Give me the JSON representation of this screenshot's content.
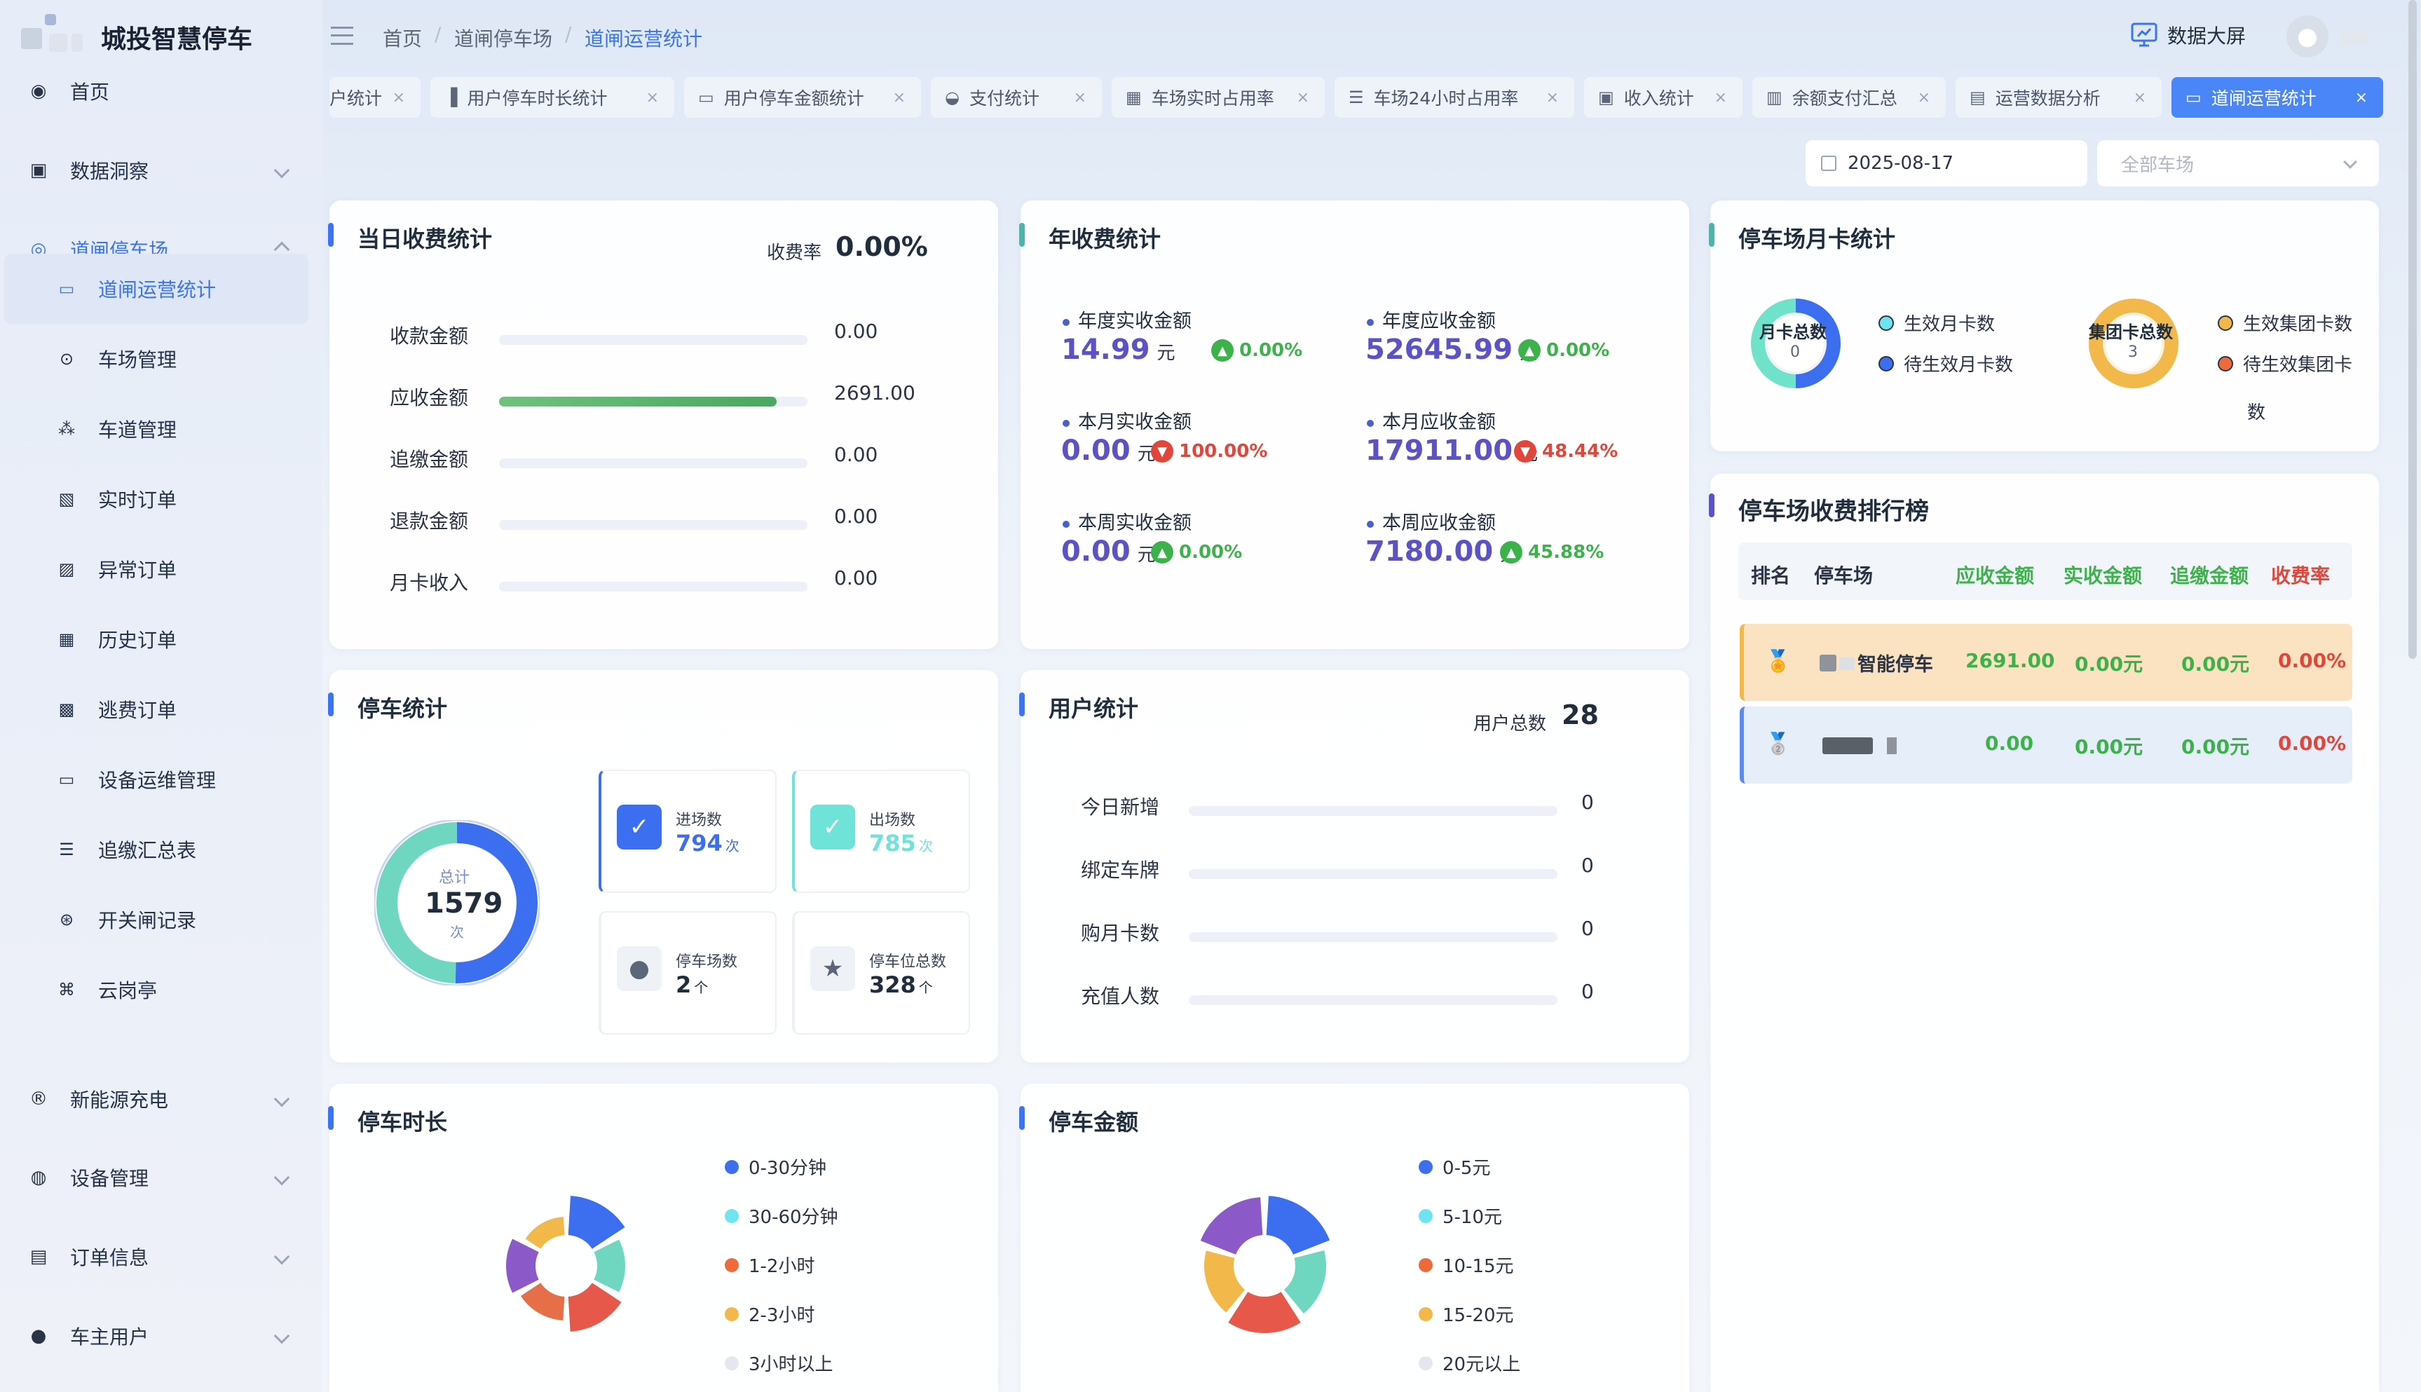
{
  "app": {
    "title": "城投智慧停车"
  },
  "breadcrumb": [
    "首页",
    "道闸停车场",
    "道闸运营统计"
  ],
  "header": {
    "bigscreen": "数据大屏"
  },
  "sidebar": {
    "items": [
      {
        "label": "首页",
        "icon": "dashboard-icon"
      },
      {
        "label": "数据洞察",
        "icon": "monitor-chart-icon"
      },
      {
        "label": "道闸停车场",
        "icon": "location-icon"
      },
      {
        "label": "新能源充电",
        "icon": "charge-icon"
      },
      {
        "label": "设备管理",
        "icon": "device-icon"
      },
      {
        "label": "订单信息",
        "icon": "order-icon"
      },
      {
        "label": "车主用户",
        "icon": "user-icon"
      }
    ],
    "sub": [
      {
        "label": "道闸运营统计",
        "icon": "monitor-icon"
      },
      {
        "label": "车场管理",
        "icon": "pin-icon"
      },
      {
        "label": "车道管理",
        "icon": "lane-icon"
      },
      {
        "label": "实时订单",
        "icon": "realtime-order-icon"
      },
      {
        "label": "异常订单",
        "icon": "abnormal-order-icon"
      },
      {
        "label": "历史订单",
        "icon": "history-order-icon"
      },
      {
        "label": "逃费订单",
        "icon": "evade-order-icon"
      },
      {
        "label": "设备运维管理",
        "icon": "maintenance-icon"
      },
      {
        "label": "追缴汇总表",
        "icon": "list-icon"
      },
      {
        "label": "开关闸记录",
        "icon": "gate-record-icon"
      },
      {
        "label": "云岗亭",
        "icon": "cloud-booth-icon"
      }
    ]
  },
  "tabs": [
    "户统计",
    "用户停车时长统计",
    "用户停车金额统计",
    "支付统计",
    "车场实时占用率",
    "车场24小时占用率",
    "收入统计",
    "余额支付汇总",
    "运营数据分析",
    "道闸运营统计"
  ],
  "filters": {
    "date": "2025-08-17",
    "parking_placeholder": "全部车场"
  },
  "daily": {
    "title": "当日收费统计",
    "rate_label": "收费率",
    "rate": "0.00%",
    "rows": [
      {
        "label": "收款金额",
        "value": "0.00",
        "fraction": 0
      },
      {
        "label": "应收金额",
        "value": "2691.00",
        "fraction": 0.9
      },
      {
        "label": "追缴金额",
        "value": "0.00",
        "fraction": 0
      },
      {
        "label": "退款金额",
        "value": "0.00",
        "fraction": 0
      },
      {
        "label": "月卡收入",
        "value": "0.00",
        "fraction": 0
      }
    ]
  },
  "annual": {
    "title": "年收费统计",
    "unit": "元",
    "stats": [
      {
        "label": "年度实收金额",
        "value": "14.99",
        "trend": "0.00%",
        "dir": "up"
      },
      {
        "label": "年度应收金额",
        "value": "52645.99",
        "trend": "0.00%",
        "dir": "up"
      },
      {
        "label": "本月实收金额",
        "value": "0.00",
        "trend": "100.00%",
        "dir": "down"
      },
      {
        "label": "本月应收金额",
        "value": "17911.00",
        "trend": "48.44%",
        "dir": "down"
      },
      {
        "label": "本周实收金额",
        "value": "0.00",
        "trend": "0.00%",
        "dir": "up"
      },
      {
        "label": "本周应收金额",
        "value": "7180.00",
        "trend": "45.88%",
        "dir": "up"
      }
    ]
  },
  "monthly_card": {
    "title": "停车场月卡统计",
    "month_total_label": "月卡总数",
    "month_total": "0",
    "group_total_label": "集团卡总数",
    "group_total": "3",
    "legend": [
      {
        "label": "生效月卡数",
        "color": "#6fe3f0"
      },
      {
        "label": "待生效月卡数",
        "color": "#3b6ff0"
      },
      {
        "label": "生效集团卡数",
        "color": "#f2b94a"
      },
      {
        "label": "待生效集团卡",
        "color": "#ee6a3a"
      }
    ],
    "legend_wrap": "数"
  },
  "ranking": {
    "title": "停车场收费排行榜",
    "headers": [
      "排名",
      "停车场",
      "应收金额",
      "实收金额",
      "追缴金额",
      "收费率"
    ],
    "rows": [
      {
        "name": "智能停车",
        "receivable": "2691.00",
        "received": "0.00元",
        "recovered": "0.00元",
        "rate": "0.00%"
      },
      {
        "name": "",
        "receivable": "0.00",
        "received": "0.00元",
        "recovered": "0.00元",
        "rate": "0.00%"
      }
    ]
  },
  "parking": {
    "title": "停车统计",
    "total_label": "总计",
    "total": "1579",
    "total_unit": "次",
    "in_ratio": 0.503,
    "boxes": [
      {
        "label": "进场数",
        "value": "794",
        "unit": "次",
        "color": "#3b6ff0"
      },
      {
        "label": "出场数",
        "value": "785",
        "unit": "次",
        "color": "#6fe3d8"
      },
      {
        "label": "停车场数",
        "value": "2",
        "unit": "个",
        "color": "#5b6678"
      },
      {
        "label": "停车位总数",
        "value": "328",
        "unit": "个",
        "color": "#5b6678"
      }
    ]
  },
  "users": {
    "title": "用户统计",
    "total_label": "用户总数",
    "total": "28",
    "rows": [
      {
        "label": "今日新增",
        "value": "0"
      },
      {
        "label": "绑定车牌",
        "value": "0"
      },
      {
        "label": "购月卡数",
        "value": "0"
      },
      {
        "label": "充值人数",
        "value": "0"
      }
    ]
  },
  "duration": {
    "title": "停车时长",
    "legend": [
      {
        "label": "0-30分钟",
        "color": "#3b6ff0"
      },
      {
        "label": "30-60分钟",
        "color": "#6fe3f0"
      },
      {
        "label": "1-2小时",
        "color": "#ee6a3a"
      },
      {
        "label": "2-3小时",
        "color": "#f2b94a"
      },
      {
        "label": "3小时以上",
        "color": "#e4e8ee"
      }
    ]
  },
  "amount": {
    "title": "停车金额",
    "legend": [
      {
        "label": "0-5元",
        "color": "#3b6ff0"
      },
      {
        "label": "5-10元",
        "color": "#6fe3f0"
      },
      {
        "label": "10-15元",
        "color": "#ee6a3a"
      },
      {
        "label": "15-20元",
        "color": "#f2b94a"
      },
      {
        "label": "20元以上",
        "color": "#e4e8ee"
      }
    ]
  }
}
